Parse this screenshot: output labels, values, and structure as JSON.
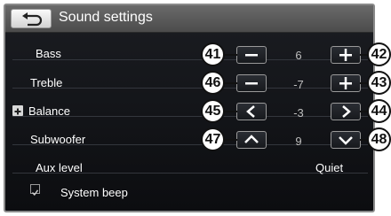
{
  "title": "Sound settings",
  "rows": {
    "bass": {
      "label": "Bass",
      "value": "6",
      "left_callout": "41",
      "right_callout": "42"
    },
    "treble": {
      "label": "Treble",
      "value": "-7",
      "left_callout": "46",
      "right_callout": "43"
    },
    "balance": {
      "label": "Balance",
      "value": "-3",
      "left_callout": "45",
      "right_callout": "44"
    },
    "subwoofer": {
      "label": "Subwoofer",
      "value": "9",
      "left_callout": "47",
      "right_callout": "48"
    },
    "aux": {
      "label": "Aux level",
      "value": "Quiet"
    },
    "system_beep": {
      "label": "System beep",
      "checked": true
    }
  },
  "icons": {
    "back": "back-arrow-icon",
    "decrease": "minus-icon",
    "increase": "plus-icon",
    "left": "chevron-left-icon",
    "right": "chevron-right-icon",
    "up": "chevron-up-icon",
    "down": "chevron-down-icon",
    "expand": "plus-square-icon",
    "checkbox": "checkbox-icon"
  },
  "colors": {
    "screen_bg": "#111317",
    "titlebar": "#5a5a5a",
    "text": "#ffffff",
    "value_text": "#bfbfbf"
  }
}
